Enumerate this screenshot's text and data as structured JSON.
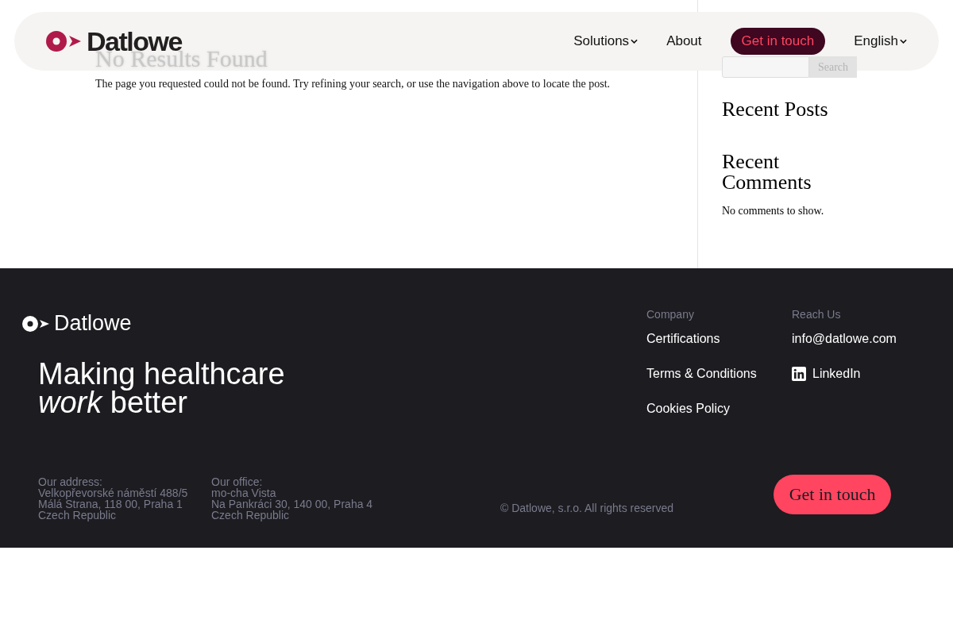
{
  "header": {
    "logo": "Datlowe",
    "nav": [
      {
        "label": "Solutions",
        "kind": "link",
        "dropdown": true
      },
      {
        "label": "About",
        "kind": "link",
        "dropdown": false
      },
      {
        "label": "Get in touch",
        "kind": "cta",
        "dropdown": false
      },
      {
        "label": "English",
        "kind": "link",
        "dropdown": true
      }
    ]
  },
  "main": {
    "heading": "No Results Found",
    "message": "The page you requested could not be found. Try refining your search, or use the navigation above to locate the post."
  },
  "sidebar": {
    "search": {
      "button": "Search"
    },
    "widgets": [
      {
        "title": "Recent Posts"
      },
      {
        "title": "Recent Comments",
        "text": "No comments to show."
      }
    ]
  },
  "footer": {
    "logo": "Datlowe",
    "tagline": "Making healthcare *work* better",
    "columns": [
      {
        "heading": "Company",
        "links": [
          {
            "label": "Certifications",
            "kind": "text"
          },
          {
            "label": "Terms & Conditions",
            "kind": "text"
          },
          {
            "label": "Cookies Policy",
            "kind": "text"
          }
        ]
      },
      {
        "heading": "Reach Us",
        "links": [
          {
            "label": "info@datlowe.com",
            "kind": "text"
          },
          {
            "label": "LinkedIn",
            "kind": "linkedin"
          }
        ]
      }
    ],
    "addresses": [
      {
        "label": "Our address:",
        "lines": [
          "Velkopřevorské náměstí 488/5",
          "Málá Strana, 118 00, Praha 1",
          "Czech Republic"
        ]
      },
      {
        "label": "Our office:",
        "lines": [
          "mo-cha Vista",
          "Na Pankráci 30, 140 00, Praha 4",
          "Czech Republic"
        ]
      }
    ],
    "copyright": "© Datlowe, s.r.o. All rights reserved",
    "cta": "Get in touch"
  }
}
